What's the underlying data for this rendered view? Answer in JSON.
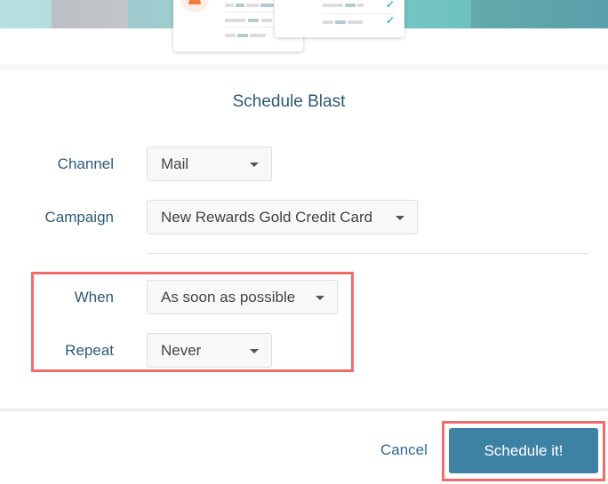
{
  "dialog": {
    "title": "Schedule Blast"
  },
  "form": {
    "channel": {
      "label": "Channel",
      "value": "Mail"
    },
    "campaign": {
      "label": "Campaign",
      "value": "New Rewards Gold Credit Card"
    },
    "when": {
      "label": "When",
      "value": "As soon as possible"
    },
    "repeat": {
      "label": "Repeat",
      "value": "Never"
    }
  },
  "footer": {
    "cancel_label": "Cancel",
    "submit_label": "Schedule it!"
  },
  "colors": {
    "accent": "#3e82a3",
    "label_text": "#2d5a70",
    "highlight": "#f26b6b",
    "avatar": "#f47a3b",
    "check": "#4fb3c3"
  },
  "icons": {
    "caret": "caret-down-icon",
    "check": "✓",
    "person": "person-icon"
  }
}
